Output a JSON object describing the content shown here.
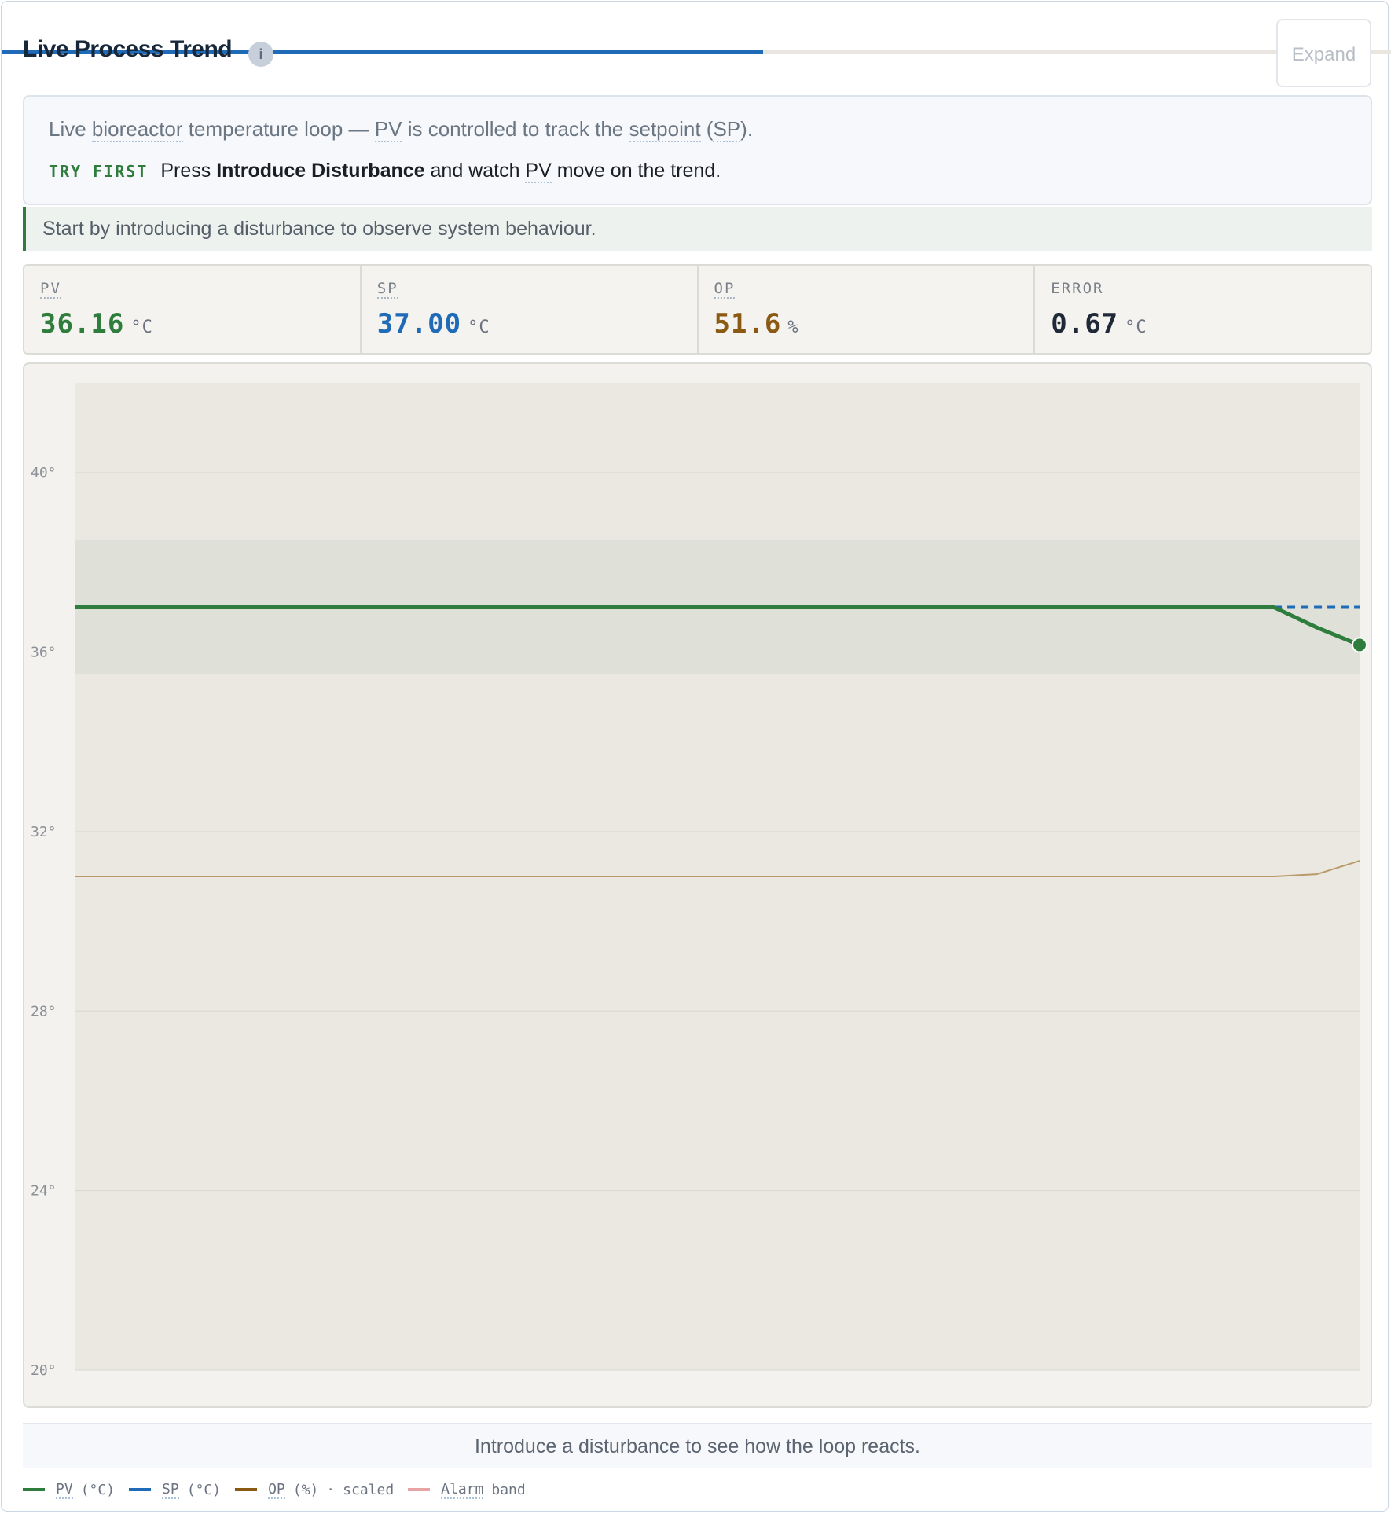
{
  "header": {
    "title": "Live Process Trend",
    "info_icon": "i",
    "expand_label": "Expand",
    "progress": 0.548
  },
  "intro": {
    "seg1": "Live ",
    "t1": "bioreactor",
    "seg2": " temperature loop — ",
    "t2": "PV",
    "seg3": " is controlled to track the ",
    "t3": "setpoint",
    "seg4": " (",
    "t4": "SP",
    "seg5": ").",
    "try_tag": "TRY FIRST",
    "try_a": "Press ",
    "try_bold": "Introduce Disturbance",
    "try_b": " and watch ",
    "try_term": "PV",
    "try_c": " move on the trend."
  },
  "hint": "Start by introducing a disturbance to observe system behaviour.",
  "stats": [
    {
      "label": "PV",
      "value": "36.16",
      "unit": "°C",
      "color": "#2e7d3c"
    },
    {
      "label": "SP",
      "value": "37.00",
      "unit": "°C",
      "color": "#1f6bb8"
    },
    {
      "label": "OP",
      "value": "51.6",
      "unit": "%",
      "color": "#8a5a12"
    },
    {
      "label": "ERROR",
      "value": "0.67",
      "unit": "°C",
      "color": "#1f2937"
    }
  ],
  "chart_data": {
    "type": "line",
    "ylim": [
      20,
      42
    ],
    "yticks": [
      "40°",
      "36°",
      "32°",
      "28°",
      "24°",
      "20°"
    ],
    "ytick_values": [
      40,
      36,
      32,
      28,
      24,
      20
    ],
    "grid": true,
    "alarm_band": [
      35.5,
      38.5
    ],
    "x": [
      0,
      1,
      2,
      3,
      4,
      5,
      6,
      7,
      8,
      9,
      10,
      11,
      12,
      13,
      14,
      15,
      16,
      17,
      18,
      19,
      20,
      21,
      22,
      23,
      24,
      25,
      26,
      27,
      28,
      29,
      30
    ],
    "series": [
      {
        "name": "PV (°C)",
        "color": "#2e7d3c",
        "values": [
          37,
          37,
          37,
          37,
          37,
          37,
          37,
          37,
          37,
          37,
          37,
          37,
          37,
          37,
          37,
          37,
          37,
          37,
          37,
          37,
          37,
          37,
          37,
          37,
          37,
          37,
          37,
          37,
          37,
          36.55,
          36.16
        ]
      },
      {
        "name": "SP (°C)",
        "color": "#1f6bb8",
        "values": [
          37,
          37,
          37,
          37,
          37,
          37,
          37,
          37,
          37,
          37,
          37,
          37,
          37,
          37,
          37,
          37,
          37,
          37,
          37,
          37,
          37,
          37,
          37,
          37,
          37,
          37,
          37,
          37,
          37,
          37,
          37
        ]
      },
      {
        "name": "OP (%) · scaled",
        "color": "#b89a6a",
        "values": [
          31,
          31,
          31,
          31,
          31,
          31,
          31,
          31,
          31,
          31,
          31,
          31,
          31,
          31,
          31,
          31,
          31,
          31,
          31,
          31,
          31,
          31,
          31,
          31,
          31,
          31,
          31,
          31,
          31,
          31.05,
          31.35
        ]
      }
    ]
  },
  "footer": "Introduce a disturbance to see how the loop reacts.",
  "legend": {
    "pv": "PV",
    "pv_unit": "(°C)",
    "sp": "SP",
    "sp_unit": "(°C)",
    "op": "OP",
    "op_unit": "(%)",
    "op_sep": "·",
    "op_note": "scaled",
    "alarm": "Alarm",
    "alarm_note": "band",
    "colors": {
      "pv": "#2e7d3c",
      "sp": "#1f6bb8",
      "op": "#8a5a12",
      "alarm": "#e8a4a4"
    }
  }
}
